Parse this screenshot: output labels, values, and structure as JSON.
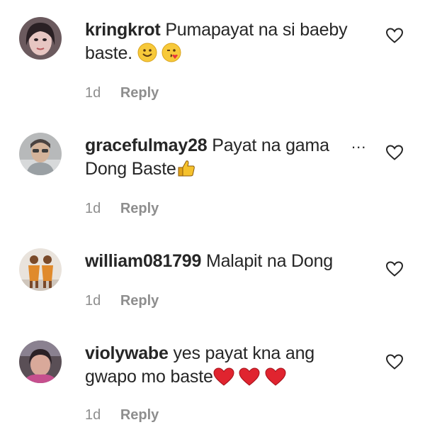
{
  "comments": [
    {
      "username": "kringkrot",
      "text_line1": "Pumapayat na si baeby",
      "text_line2": "baste.",
      "emojis": [
        "slightly-smiling-face-emoji",
        "face-blowing-kiss-emoji"
      ],
      "time": "1d",
      "reply": "Reply"
    },
    {
      "username": "gracefulmay28",
      "text_line1": "Payat na gama",
      "more": "...",
      "text_line2": "Dong Baste",
      "emojis": [
        "thumbs-up-emoji"
      ],
      "time": "1d",
      "reply": "Reply"
    },
    {
      "username": "william081799",
      "text_line1": "Malapit na Dong",
      "time": "1d",
      "reply": "Reply"
    },
    {
      "username": "violywabe",
      "text_line1": "yes payat kna ang",
      "text_line2": "gwapo mo baste",
      "emojis": [
        "red-heart-emoji",
        "red-heart-emoji",
        "red-heart-emoji"
      ],
      "time": "1d",
      "reply": "Reply"
    }
  ]
}
